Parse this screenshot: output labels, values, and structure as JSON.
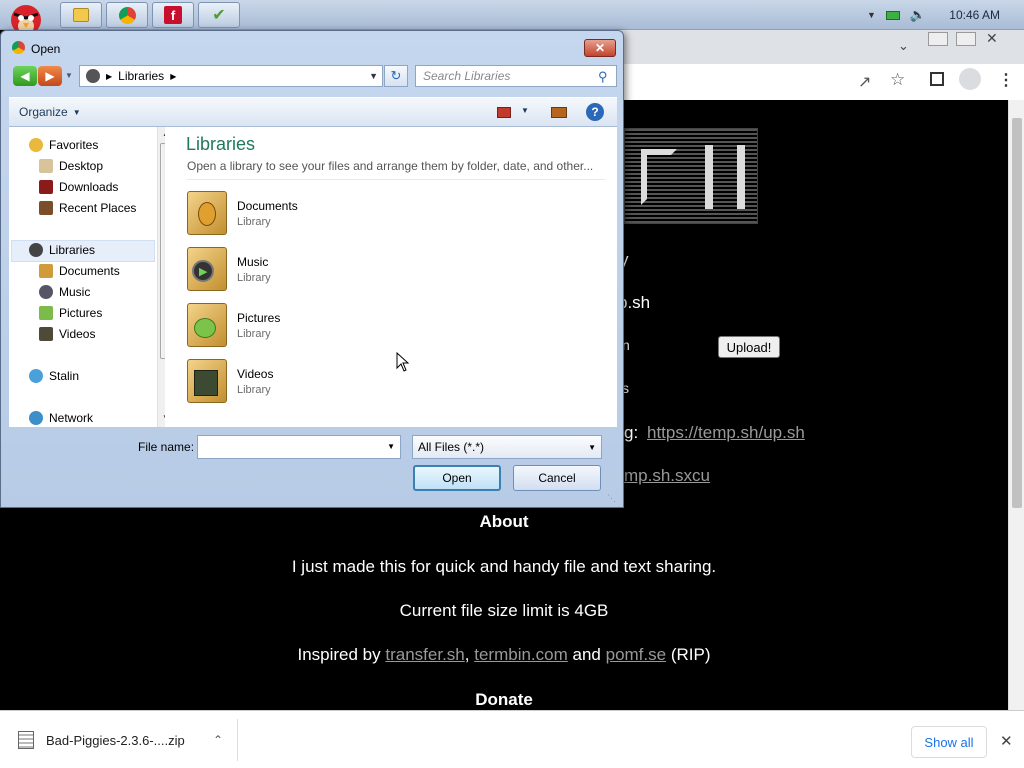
{
  "taskbar": {
    "clock": "10:46 AM",
    "apps": [
      "angry-birds",
      "explorer",
      "chrome",
      "flash",
      "security"
    ]
  },
  "dialog": {
    "title": "Open",
    "address": "Libraries",
    "search_placeholder": "Search Libraries",
    "organize_label": "Organize",
    "nav": {
      "favorites": "Favorites",
      "desktop": "Desktop",
      "downloads": "Downloads",
      "recent": "Recent Places",
      "libraries": "Libraries",
      "documents": "Documents",
      "music": "Music",
      "pictures": "Pictures",
      "videos": "Videos",
      "homegroup": "Stalin",
      "network": "Network"
    },
    "content": {
      "heading": "Libraries",
      "subheading": "Open a library to see your files and arrange them by folder, date, and other...",
      "items": [
        {
          "name": "Documents",
          "type": "Library"
        },
        {
          "name": "Music",
          "type": "Library"
        },
        {
          "name": "Pictures",
          "type": "Library"
        },
        {
          "name": "Videos",
          "type": "Library"
        }
      ]
    },
    "filename_label": "File name:",
    "filename_value": "",
    "filetype_value": "All Files (*.*)",
    "open_label": "Open",
    "cancel_label": "Cancel"
  },
  "page": {
    "frag1": "y",
    "frag2": "p.sh",
    "frag3": "n",
    "frag4": "s",
    "frag5": "g:",
    "link1": "https://temp.sh/up.sh",
    "link2": "mp.sh.sxcu",
    "upload_label": "Upload!",
    "about_title": "About",
    "about_text": "I just made this for quick and handy file and text sharing.",
    "limit_text": "Current file size limit is 4GB",
    "inspired_prefix": "Inspired by",
    "inspired_link1": "transfer.sh",
    "inspired_sep": ",",
    "inspired_link2": "termbin.com",
    "inspired_and": "and",
    "inspired_link3": "pomf.se",
    "inspired_suffix": "(RIP)",
    "donate_title": "Donate"
  },
  "downloads": {
    "file": "Bad-Piggies-2.3.6-....zip",
    "show_all": "Show all"
  },
  "colors": {
    "dialog_heading": "#1e7a5a",
    "link": "#999999",
    "accent": "#1a73e8"
  }
}
